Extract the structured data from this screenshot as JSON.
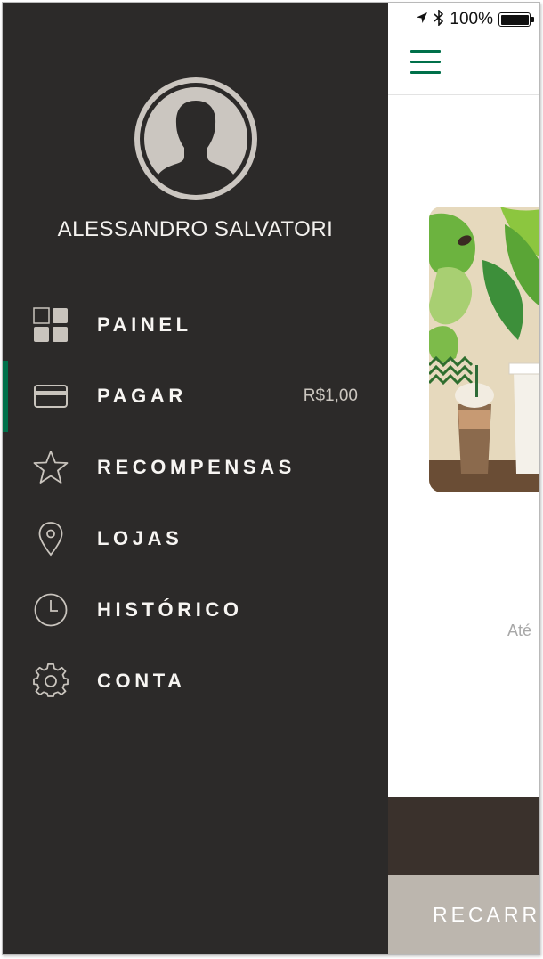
{
  "status_bar": {
    "battery_text": "100%",
    "icons": [
      "location-arrow-icon",
      "bluetooth-icon",
      "battery-icon"
    ]
  },
  "drawer": {
    "user_name": "ALESSANDRO SALVATORI",
    "menu": [
      {
        "id": "painel",
        "label": "PAINEL",
        "icon": "dashboard-grid-icon"
      },
      {
        "id": "pagar",
        "label": "PAGAR",
        "icon": "credit-card-icon",
        "value": "R$1,00",
        "active": true
      },
      {
        "id": "recompensas",
        "label": "RECOMPENSAS",
        "icon": "star-icon"
      },
      {
        "id": "lojas",
        "label": "LOJAS",
        "icon": "location-pin-icon"
      },
      {
        "id": "historico",
        "label": "HISTÓRICO",
        "icon": "clock-icon"
      },
      {
        "id": "conta",
        "label": "CONTA",
        "icon": "gear-icon"
      }
    ]
  },
  "main": {
    "caption": "Até",
    "recharge_label": "RECARR"
  },
  "colors": {
    "drawer_bg": "#2c2a29",
    "accent_green": "#00704a",
    "menu_icon": "#c9c4bd",
    "recharge_bg": "#bcb6ae"
  }
}
